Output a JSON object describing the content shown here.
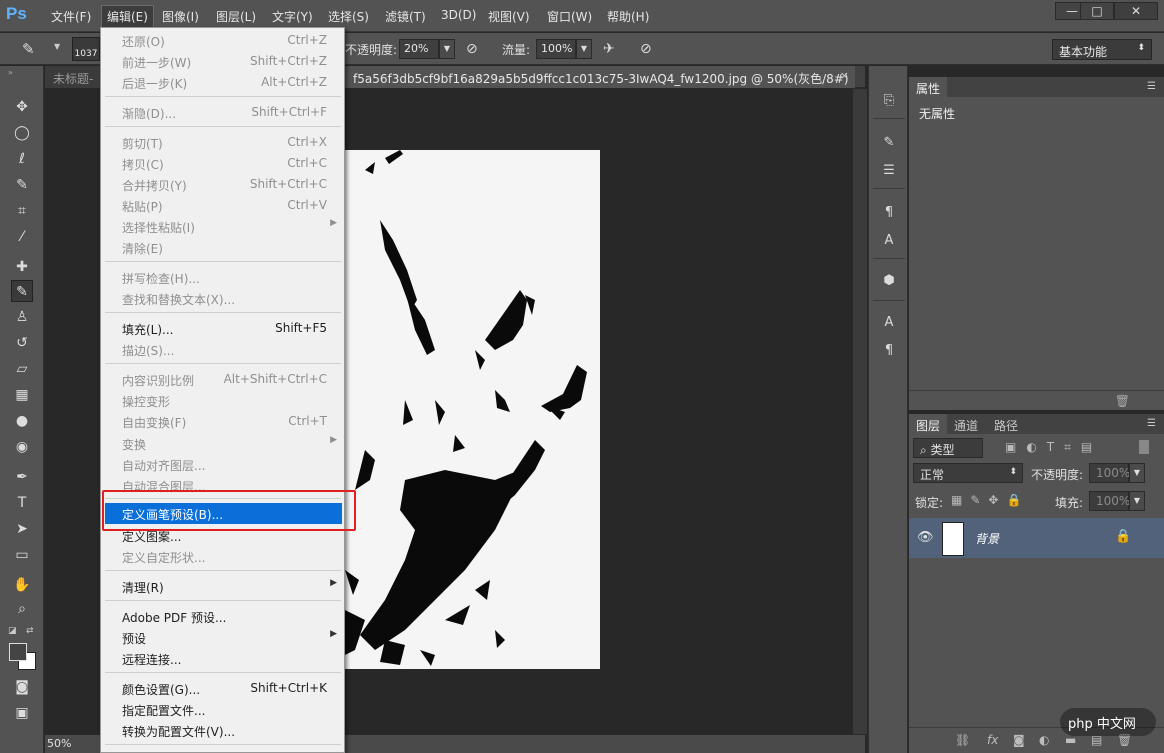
{
  "app": {
    "logo": "Ps",
    "menus": [
      "文件(F)",
      "编辑(E)",
      "图像(I)",
      "图层(L)",
      "文字(Y)",
      "选择(S)",
      "滤镜(T)",
      "3D(D)",
      "视图(V)",
      "窗口(W)",
      "帮助(H)"
    ],
    "active_menu": "编辑(E)",
    "window_controls": {
      "minimize": "—",
      "maximize": "□",
      "close": "✕"
    }
  },
  "options": {
    "brush_size": "1037",
    "opacity_label": "不透明度:",
    "opacity_value": "20%",
    "flow_label": "流量:",
    "flow_value": "100%",
    "workspace": "基本功能"
  },
  "tabs": [
    {
      "label": "未标题-"
    },
    {
      "label": "f5a56f3db5cf9bf16a829a5b5d9ffcc1c013c75-3IwAQ4_fw1200.jpg @ 50%(灰色/8#)",
      "close": "×"
    }
  ],
  "status": {
    "zoom": "50%"
  },
  "properties": {
    "tab": "属性",
    "content": "无属性"
  },
  "layers_panel": {
    "tabs": [
      "图层",
      "通道",
      "路径"
    ],
    "filter": "类型",
    "blend_mode": "正常",
    "opacity_label": "不透明度:",
    "opacity_value": "100%",
    "lock_label": "锁定:",
    "fill_label": "填充:",
    "fill_value": "100%",
    "layer_name": "背景"
  },
  "edit_menu": {
    "undo": {
      "label": "还原(O)",
      "shortcut": "Ctrl+Z"
    },
    "step_forward": {
      "label": "前进一步(W)",
      "shortcut": "Shift+Ctrl+Z"
    },
    "step_backward": {
      "label": "后退一步(K)",
      "shortcut": "Alt+Ctrl+Z"
    },
    "fade": {
      "label": "渐隐(D)...",
      "shortcut": "Shift+Ctrl+F"
    },
    "cut": {
      "label": "剪切(T)",
      "shortcut": "Ctrl+X"
    },
    "copy": {
      "label": "拷贝(C)",
      "shortcut": "Ctrl+C"
    },
    "copy_merged": {
      "label": "合并拷贝(Y)",
      "shortcut": "Shift+Ctrl+C"
    },
    "paste": {
      "label": "粘贴(P)",
      "shortcut": "Ctrl+V"
    },
    "paste_special": {
      "label": "选择性粘贴(I)"
    },
    "clear": {
      "label": "清除(E)"
    },
    "spelling": {
      "label": "拼写检查(H)..."
    },
    "find_replace": {
      "label": "查找和替换文本(X)..."
    },
    "fill": {
      "label": "填充(L)...",
      "shortcut": "Shift+F5"
    },
    "stroke": {
      "label": "描边(S)..."
    },
    "content_aware_scale": {
      "label": "内容识别比例",
      "shortcut": "Alt+Shift+Ctrl+C"
    },
    "puppet_warp": {
      "label": "操控变形"
    },
    "free_transform": {
      "label": "自由变换(F)",
      "shortcut": "Ctrl+T"
    },
    "transform": {
      "label": "变换"
    },
    "auto_align": {
      "label": "自动对齐图层..."
    },
    "auto_blend": {
      "label": "自动混合图层..."
    },
    "define_brush": {
      "label": "定义画笔预设(B)..."
    },
    "define_pattern": {
      "label": "定义图案..."
    },
    "define_shape": {
      "label": "定义自定形状..."
    },
    "purge": {
      "label": "清理(R)"
    },
    "pdf_presets": {
      "label": "Adobe PDF 预设..."
    },
    "presets": {
      "label": "预设"
    },
    "remote": {
      "label": "远程连接..."
    },
    "color_settings": {
      "label": "颜色设置(G)...",
      "shortcut": "Shift+Ctrl+K"
    },
    "assign_profile": {
      "label": "指定配置文件..."
    },
    "convert_profile": {
      "label": "转换为配置文件(V)..."
    }
  },
  "watermark": "php 中文网"
}
